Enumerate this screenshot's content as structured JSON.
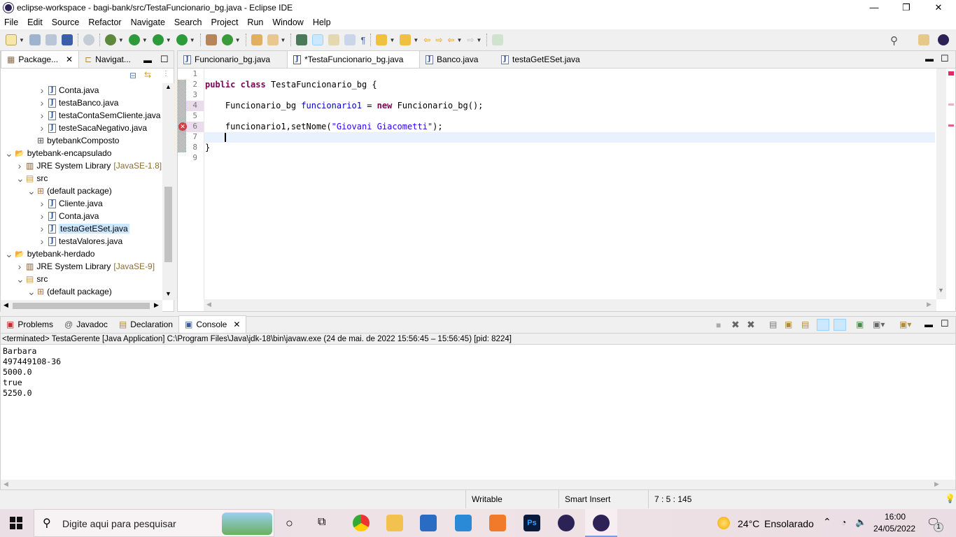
{
  "window": {
    "title": "eclipse-workspace - bagi-bank/src/TestaFuncionario_bg.java - Eclipse IDE",
    "minimize": "—",
    "maximize": "❐",
    "close": "✕"
  },
  "menu": [
    "File",
    "Edit",
    "Source",
    "Refactor",
    "Navigate",
    "Search",
    "Project",
    "Run",
    "Window",
    "Help"
  ],
  "left_panel": {
    "tabs": [
      {
        "label": "Package...",
        "close": "✕"
      },
      {
        "label": "Navigat..."
      }
    ],
    "tree": [
      {
        "label": "Conta.java",
        "level": 3,
        "icon": "java-file-icon"
      },
      {
        "label": "testaBanco.java",
        "level": 3,
        "icon": "java-file-icon"
      },
      {
        "label": "testaContaSemCliente.java",
        "level": 3,
        "icon": "java-file-icon"
      },
      {
        "label": "testeSacaNegativo.java",
        "level": 3,
        "icon": "java-file-icon"
      },
      {
        "label": "bytebankComposto",
        "level": 2,
        "icon": "package-icon",
        "nochev": true
      },
      {
        "label": "bytebank-encapsulado",
        "level": 0,
        "icon": "project-icon",
        "open": true
      },
      {
        "label": "JRE System Library",
        "extra": "[JavaSE-1.8]",
        "level": 1,
        "icon": "library-icon"
      },
      {
        "label": "src",
        "level": 1,
        "icon": "source-folder-icon",
        "open": true
      },
      {
        "label": "(default package)",
        "level": 2,
        "icon": "package-icon",
        "open": true
      },
      {
        "label": "Cliente.java",
        "level": 3,
        "icon": "java-file-icon"
      },
      {
        "label": "Conta.java",
        "level": 3,
        "icon": "java-file-icon"
      },
      {
        "label": "testaGetESet.java",
        "level": 3,
        "icon": "java-file-icon",
        "selected": true
      },
      {
        "label": "testaValores.java",
        "level": 3,
        "icon": "java-file-icon"
      },
      {
        "label": "bytebank-herdado",
        "level": 0,
        "icon": "project-icon",
        "open": true
      },
      {
        "label": "JRE System Library",
        "extra": "[JavaSE-9]",
        "level": 1,
        "icon": "library-icon"
      },
      {
        "label": "src",
        "level": 1,
        "icon": "source-folder-icon",
        "open": true
      },
      {
        "label": "(default package)",
        "level": 2,
        "icon": "package-icon",
        "open": true
      }
    ]
  },
  "editor": {
    "tabs": [
      {
        "label": "Funcionario_bg.java"
      },
      {
        "label": "*TestaFuncionario_bg.java",
        "active": true,
        "error": true,
        "close": "✕"
      },
      {
        "label": "Banco.java"
      },
      {
        "label": "testaGetESet.java"
      }
    ],
    "line_numbers": [
      "1",
      "2",
      "3",
      "4",
      "5",
      "6",
      "7",
      "8",
      "9"
    ],
    "code": {
      "l2_kw1": "public",
      "l2_kw2": "class",
      "l2_rest": " TestaFuncionario_bg {",
      "l4_a": "    Funcionario_bg ",
      "l4_fld": "funcionario1",
      "l4_b": " = ",
      "l4_kw": "new",
      "l4_c": " Funcionario_bg();",
      "l6_a": "    funcionario1,setNome(",
      "l6_str": "\"Giovani Giacometti\"",
      "l6_b": ");",
      "l8": "}"
    }
  },
  "bottom_panel": {
    "tabs": [
      {
        "label": "Problems"
      },
      {
        "label": "Javadoc"
      },
      {
        "label": "Declaration"
      },
      {
        "label": "Console",
        "active": true,
        "close": "✕"
      }
    ],
    "console_header": "<terminated> TestaGerente [Java Application] C:\\Program Files\\Java\\jdk-18\\bin\\javaw.exe  (24 de mai. de 2022 15:56:45 – 15:56:45) [pid: 8224]",
    "output": [
      "Barbara",
      "497449108-36",
      "5000.0",
      "true",
      "5250.0"
    ]
  },
  "status_bar": {
    "writable": "Writable",
    "insert_mode": "Smart Insert",
    "position": "7 : 5 : 145"
  },
  "taskbar": {
    "search_placeholder": "Digite aqui para pesquisar",
    "weather_temp": "24°C",
    "weather_text": "Ensolarado",
    "time": "16:00",
    "date": "24/05/2022",
    "notifications": "1"
  },
  "colors": {
    "keyword": "#7f0055",
    "field": "#0000c0",
    "string": "#2a00ff",
    "current_line": "#e8f2fe",
    "selection": "#cce8ff"
  }
}
